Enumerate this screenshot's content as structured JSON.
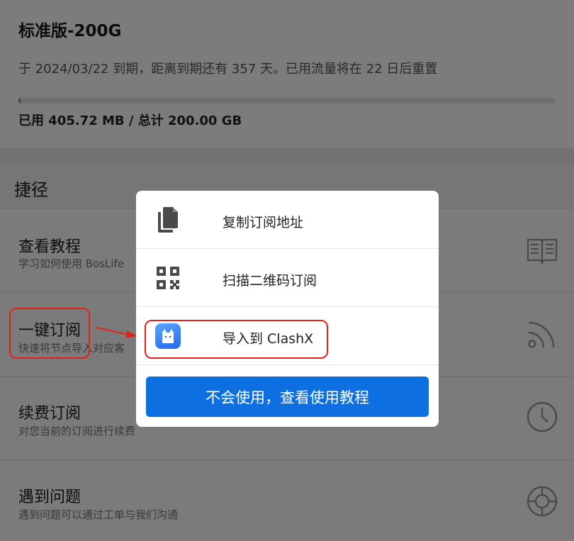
{
  "plan": {
    "name": "标准版-200G",
    "description": "于 2024/03/22 到期，距离到期还有 357 天。已用流量将在 22 日后重置",
    "usage": "已用 405.72 MB / 总计 200.00 GB",
    "usage_fraction": 0.002
  },
  "shortcuts": {
    "title": "捷径",
    "items": [
      {
        "title": "查看教程",
        "subtitle": "学习如何使用 BosLife",
        "icon": "book-icon"
      },
      {
        "title": "一键订阅",
        "subtitle": "快速将节点导入对应客",
        "icon": "rss-icon"
      },
      {
        "title": "续费订阅",
        "subtitle": "对您当前的订阅进行续费",
        "icon": "clock-icon"
      },
      {
        "title": "遇到问题",
        "subtitle": "遇到问题可以通过工单与我们沟通",
        "icon": "lifebuoy-icon"
      }
    ]
  },
  "dialog": {
    "options": [
      {
        "label": "复制订阅地址",
        "icon": "copy-icon"
      },
      {
        "label": "扫描二维码订阅",
        "icon": "qr-code-icon"
      },
      {
        "label": "导入到 ClashX",
        "icon": "clashx-app-icon"
      }
    ],
    "button_label": "不会使用，查看使用教程"
  },
  "colors": {
    "accent": "#0d6fe0",
    "annotation": "#e2231a"
  }
}
